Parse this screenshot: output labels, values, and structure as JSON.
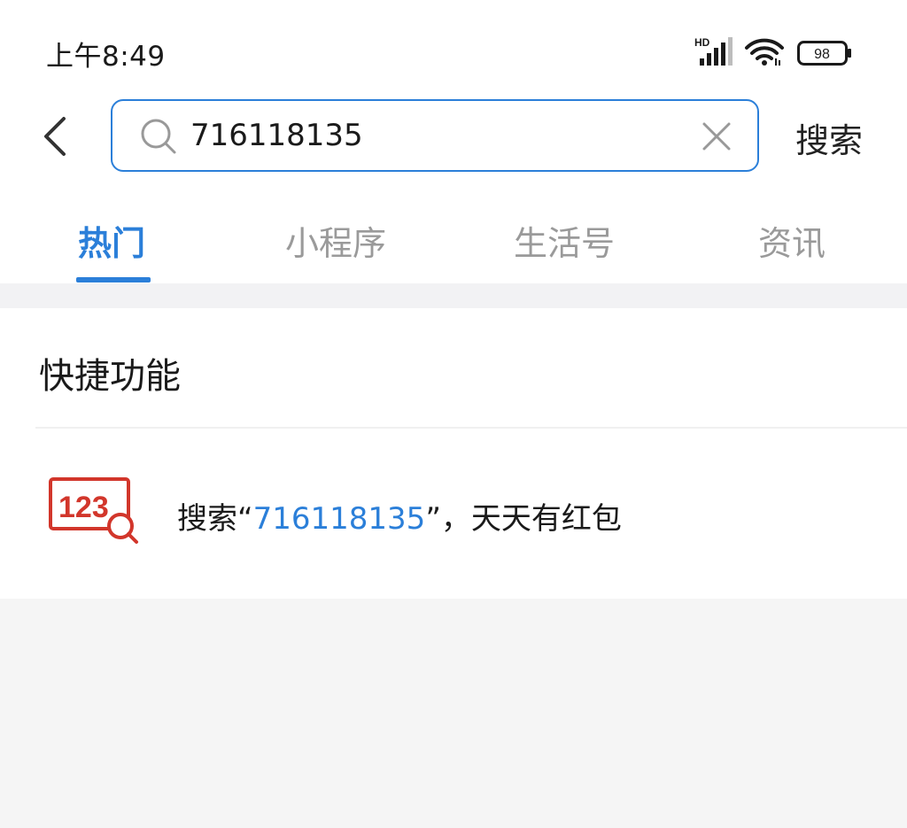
{
  "status_bar": {
    "time": "上午8:49",
    "network": "HD",
    "battery": "98"
  },
  "search": {
    "value": "716118135",
    "submit_label": "搜索"
  },
  "tabs": [
    {
      "label": "热门",
      "active": true
    },
    {
      "label": "小程序",
      "active": false
    },
    {
      "label": "生活号",
      "active": false
    },
    {
      "label": "资讯",
      "active": false
    }
  ],
  "quick_functions": {
    "title": "快捷功能",
    "items": [
      {
        "icon_text": "123",
        "prefix": "搜索“",
        "query": "716118135",
        "suffix": "”，天天有红包"
      }
    ]
  },
  "colors": {
    "accent": "#2b7fd9",
    "icon_red": "#d2362b"
  }
}
